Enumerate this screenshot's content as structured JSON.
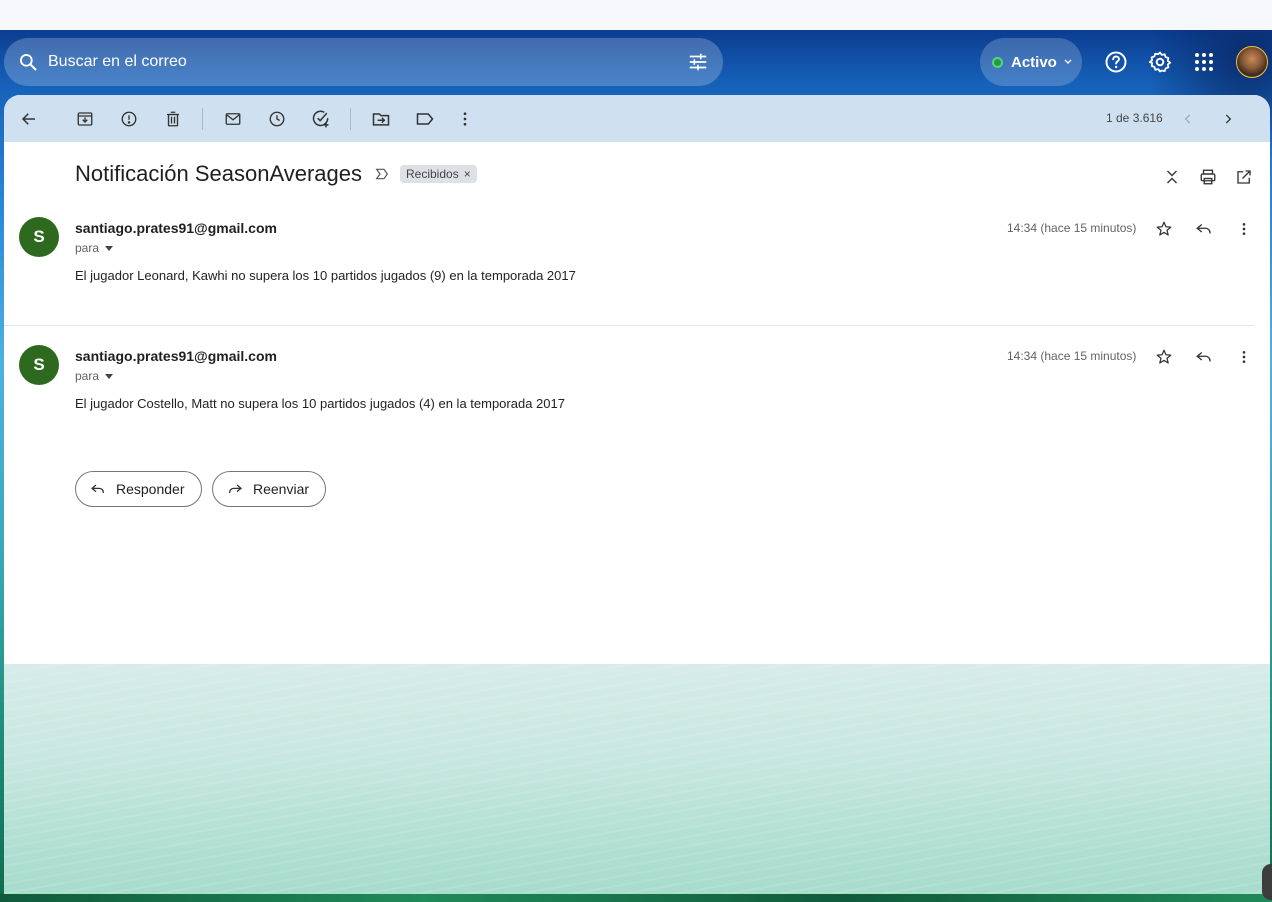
{
  "search": {
    "placeholder": "Buscar en el correo"
  },
  "status": {
    "label": "Activo",
    "color": "#1e9c4b"
  },
  "toolbar": {
    "pager": "1 de 3.616",
    "icons": [
      "back-icon",
      "archive-icon",
      "report-spam-icon",
      "delete-icon",
      "mark-unread-icon",
      "snooze-icon",
      "add-task-icon",
      "move-to-icon",
      "label-icon",
      "more-icon",
      "prev-icon",
      "next-icon"
    ]
  },
  "thread": {
    "subject": "Notificación SeasonAverages",
    "label": "Recibidos",
    "label_close": "×"
  },
  "messages": [
    {
      "avatar_letter": "S",
      "sender": "santiago.prates91@gmail.com",
      "to": "para",
      "time": "14:34 (hace 15 minutos)",
      "body": "El jugador Leonard, Kawhi no supera los 10 partidos jugados (9) en la temporada 2017"
    },
    {
      "avatar_letter": "S",
      "sender": "santiago.prates91@gmail.com",
      "to": "para",
      "time": "14:34 (hace 15 minutos)",
      "body": "El jugador Costello, Matt no supera los 10 partidos jugados (4) en la temporada 2017"
    }
  ],
  "actions": {
    "reply": "Responder",
    "forward": "Reenviar"
  },
  "colors": {
    "avatar": "#2d6a1f",
    "toolbar": "#cfe0f0",
    "accent": "#0b57d0"
  }
}
